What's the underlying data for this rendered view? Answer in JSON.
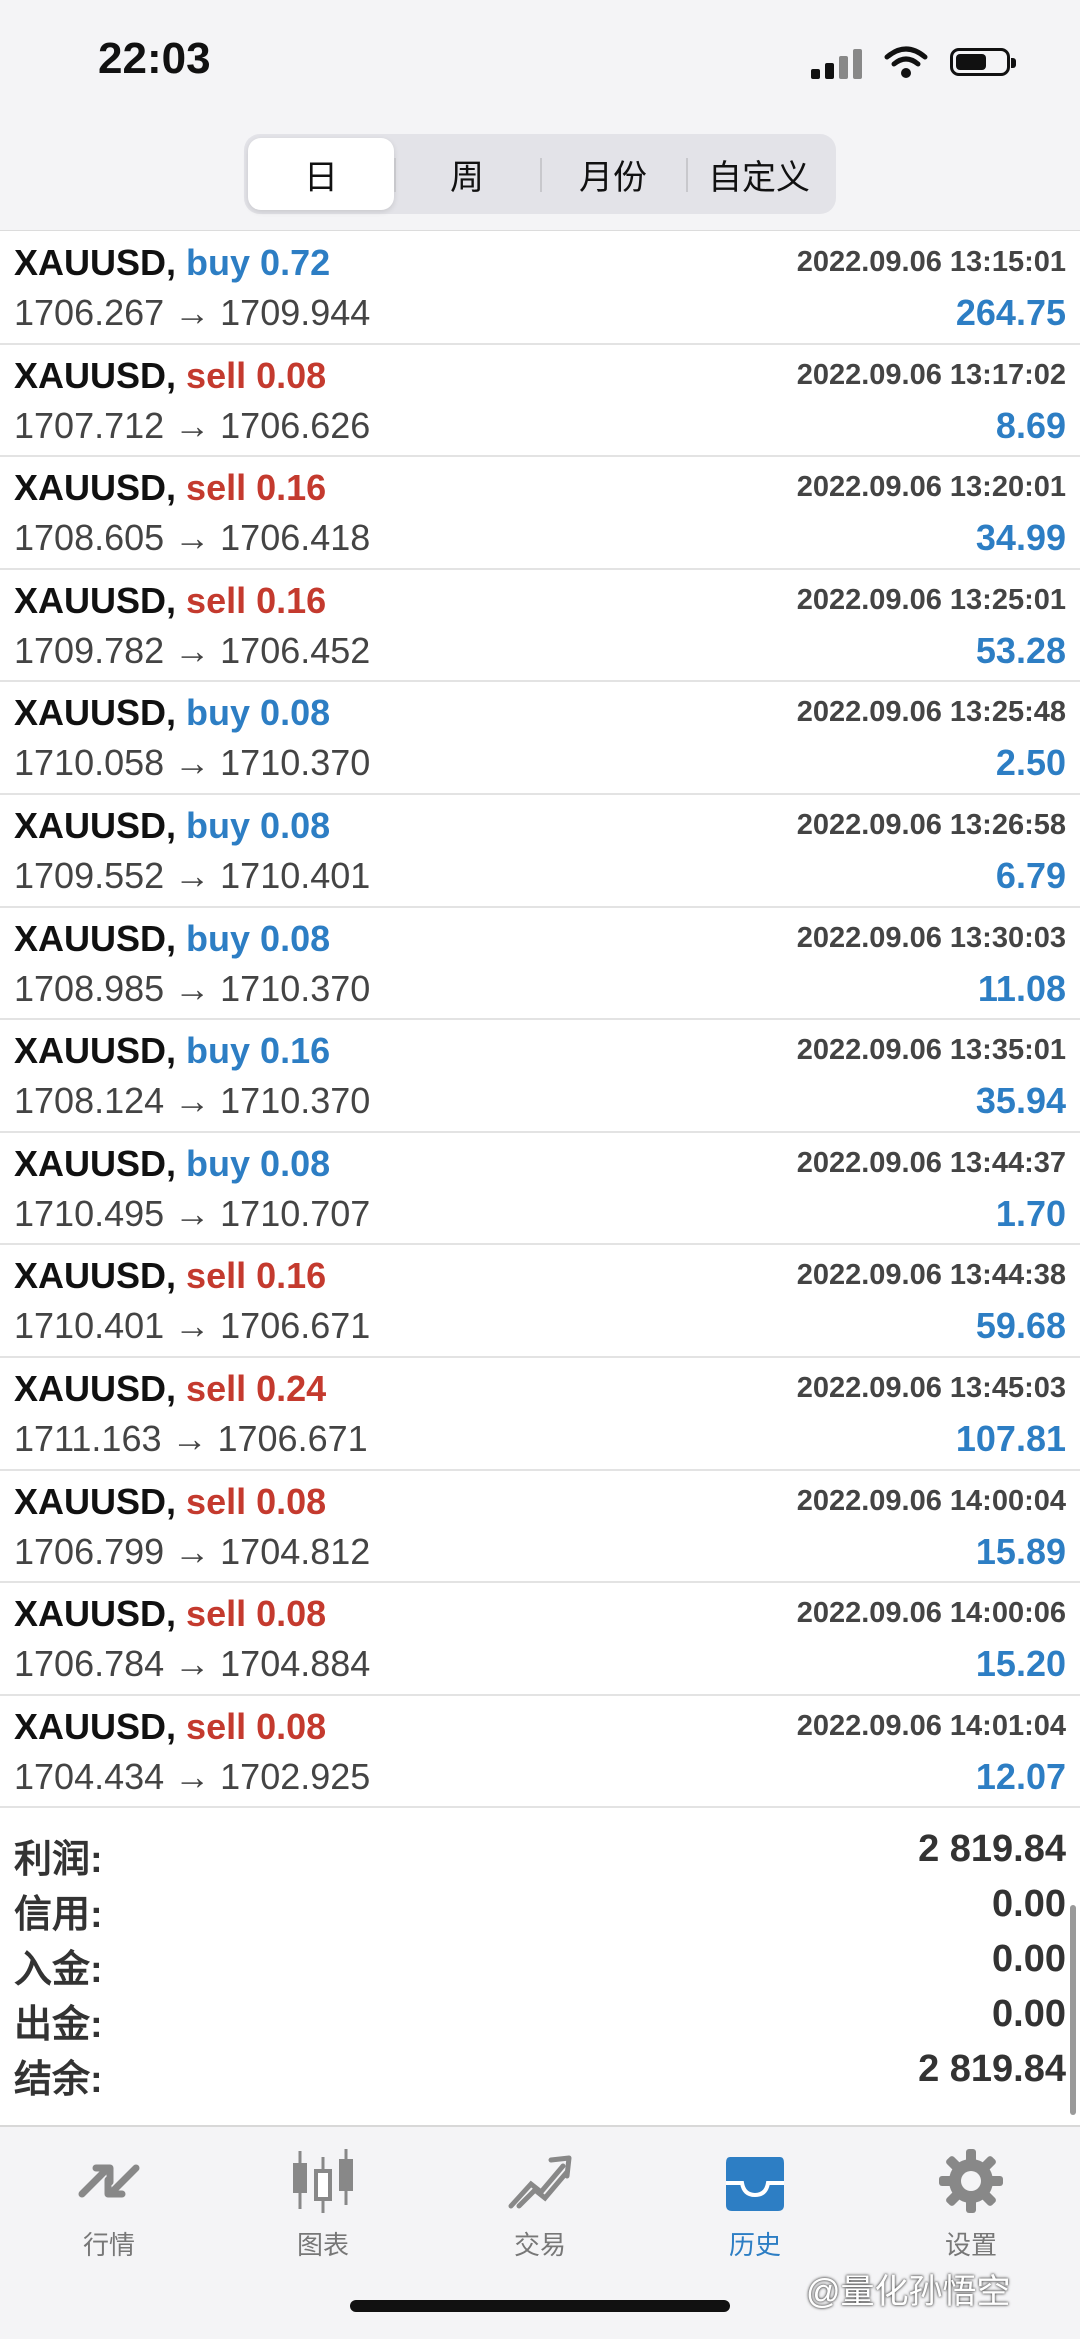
{
  "status": {
    "time": "22:03"
  },
  "segments": [
    "日",
    "周",
    "月份",
    "自定义"
  ],
  "deals": [
    {
      "symbol": "XAUUSD,",
      "side": "buy",
      "volume": "buy 0.72",
      "datetime": "2022.09.06 13:15:01",
      "prices": "1706.267 → 1709.944",
      "profit": "264.75"
    },
    {
      "symbol": "XAUUSD,",
      "side": "sell",
      "volume": "sell 0.08",
      "datetime": "2022.09.06 13:17:02",
      "prices": "1707.712 → 1706.626",
      "profit": "8.69"
    },
    {
      "symbol": "XAUUSD,",
      "side": "sell",
      "volume": "sell 0.16",
      "datetime": "2022.09.06 13:20:01",
      "prices": "1708.605 → 1706.418",
      "profit": "34.99"
    },
    {
      "symbol": "XAUUSD,",
      "side": "sell",
      "volume": "sell 0.16",
      "datetime": "2022.09.06 13:25:01",
      "prices": "1709.782 → 1706.452",
      "profit": "53.28"
    },
    {
      "symbol": "XAUUSD,",
      "side": "buy",
      "volume": "buy 0.08",
      "datetime": "2022.09.06 13:25:48",
      "prices": "1710.058 → 1710.370",
      "profit": "2.50"
    },
    {
      "symbol": "XAUUSD,",
      "side": "buy",
      "volume": "buy 0.08",
      "datetime": "2022.09.06 13:26:58",
      "prices": "1709.552 → 1710.401",
      "profit": "6.79"
    },
    {
      "symbol": "XAUUSD,",
      "side": "buy",
      "volume": "buy 0.08",
      "datetime": "2022.09.06 13:30:03",
      "prices": "1708.985 → 1710.370",
      "profit": "11.08"
    },
    {
      "symbol": "XAUUSD,",
      "side": "buy",
      "volume": "buy 0.16",
      "datetime": "2022.09.06 13:35:01",
      "prices": "1708.124 → 1710.370",
      "profit": "35.94"
    },
    {
      "symbol": "XAUUSD,",
      "side": "buy",
      "volume": "buy 0.08",
      "datetime": "2022.09.06 13:44:37",
      "prices": "1710.495 → 1710.707",
      "profit": "1.70"
    },
    {
      "symbol": "XAUUSD,",
      "side": "sell",
      "volume": "sell 0.16",
      "datetime": "2022.09.06 13:44:38",
      "prices": "1710.401 → 1706.671",
      "profit": "59.68"
    },
    {
      "symbol": "XAUUSD,",
      "side": "sell",
      "volume": "sell 0.24",
      "datetime": "2022.09.06 13:45:03",
      "prices": "1711.163 → 1706.671",
      "profit": "107.81"
    },
    {
      "symbol": "XAUUSD,",
      "side": "sell",
      "volume": "sell 0.08",
      "datetime": "2022.09.06 14:00:04",
      "prices": "1706.799 → 1704.812",
      "profit": "15.89"
    },
    {
      "symbol": "XAUUSD,",
      "side": "sell",
      "volume": "sell 0.08",
      "datetime": "2022.09.06 14:00:06",
      "prices": "1706.784 → 1704.884",
      "profit": "15.20"
    },
    {
      "symbol": "XAUUSD,",
      "side": "sell",
      "volume": "sell 0.08",
      "datetime": "2022.09.06 14:01:04",
      "prices": "1704.434 → 1702.925",
      "profit": "12.07"
    }
  ],
  "summary": [
    {
      "label": "利润:",
      "value": "2 819.84"
    },
    {
      "label": "信用:",
      "value": "0.00"
    },
    {
      "label": "入金:",
      "value": "0.00"
    },
    {
      "label": "出金:",
      "value": "0.00"
    },
    {
      "label": "结余:",
      "value": "2 819.84"
    }
  ],
  "tabs": [
    {
      "label": "行情",
      "icon": "quotes-icon"
    },
    {
      "label": "图表",
      "icon": "chart-icon"
    },
    {
      "label": "交易",
      "icon": "trade-icon"
    },
    {
      "label": "历史",
      "icon": "history-icon"
    },
    {
      "label": "设置",
      "icon": "settings-icon"
    }
  ],
  "watermark": "@量化孙悟空",
  "colors": {
    "buy": "#2d7ec4",
    "sell": "#c43a2e",
    "profit": "#2d7ec4",
    "active_tab": "#2d7ec4"
  }
}
